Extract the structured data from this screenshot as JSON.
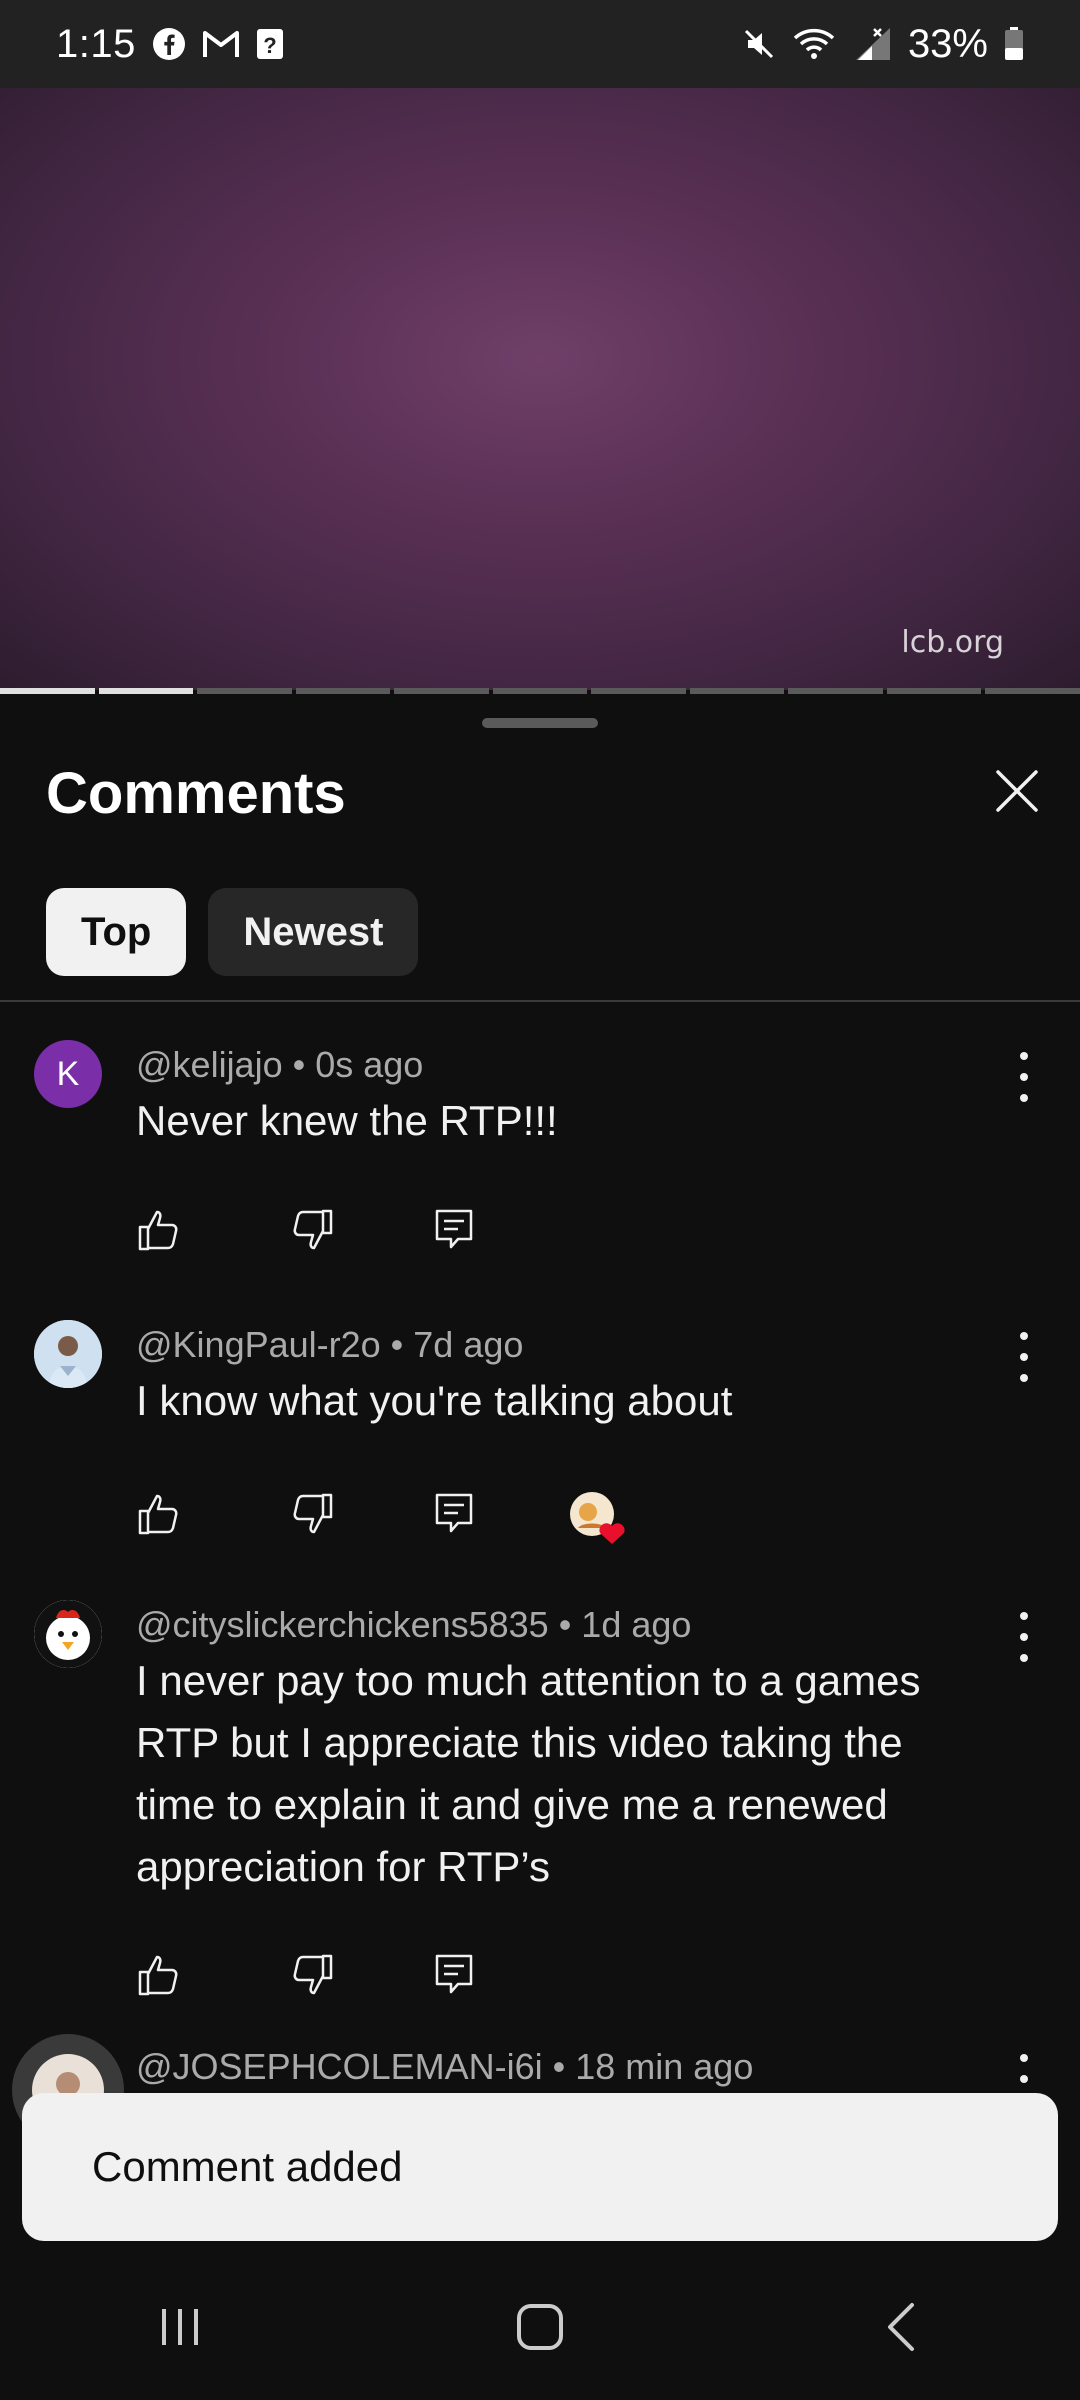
{
  "status_bar": {
    "time": "1:15",
    "battery": "33%",
    "left_icons": [
      "facebook-icon",
      "gmail-icon",
      "unknown-notification-icon"
    ],
    "right_icons": [
      "mute-icon",
      "wifi-icon",
      "signal-icon",
      "battery-icon"
    ]
  },
  "video": {
    "watermark": "lcb.org",
    "progress_segments": 11,
    "progress_played_segments": 2
  },
  "sheet": {
    "title": "Comments",
    "close_icon": "close-icon",
    "chips": [
      {
        "label": "Top",
        "active": true
      },
      {
        "label": "Newest",
        "active": false
      }
    ]
  },
  "comments": [
    {
      "avatar_letter": "K",
      "author": "@kelijajo",
      "time": "0s ago",
      "meta": "@kelijajo • 0s ago",
      "text": "Never knew the RTP!!!",
      "creator_heart": false
    },
    {
      "author": "@KingPaul-r2o",
      "time": "7d ago",
      "meta": "@KingPaul-r2o • 7d ago",
      "text": "I know what you're talking about",
      "creator_heart": true
    },
    {
      "author": "@cityslickerchickens5835",
      "time": "1d ago",
      "meta": "@cityslickerchickens5835 • 1d ago",
      "text": "I never pay too much attention to a games RTP but I appreciate this video taking the time to explain it and give me a renewed appreciation for RTP’s",
      "creator_heart": false
    },
    {
      "author": "@JOSEPHCOLEMAN-i6i",
      "time": "18 min ago",
      "meta": "@JOSEPHCOLEMAN-i6i • 18 min ago"
    }
  ],
  "toast": {
    "text": "Comment added"
  },
  "nav": {
    "icons": [
      "recents-icon",
      "home-icon",
      "back-icon"
    ]
  },
  "colors": {
    "background": "#0f0f0f",
    "chip_active": "#f1f1f1",
    "chip_inactive": "#272727",
    "avatar_k": "#7a2ea8",
    "heart": "#e8102a"
  }
}
